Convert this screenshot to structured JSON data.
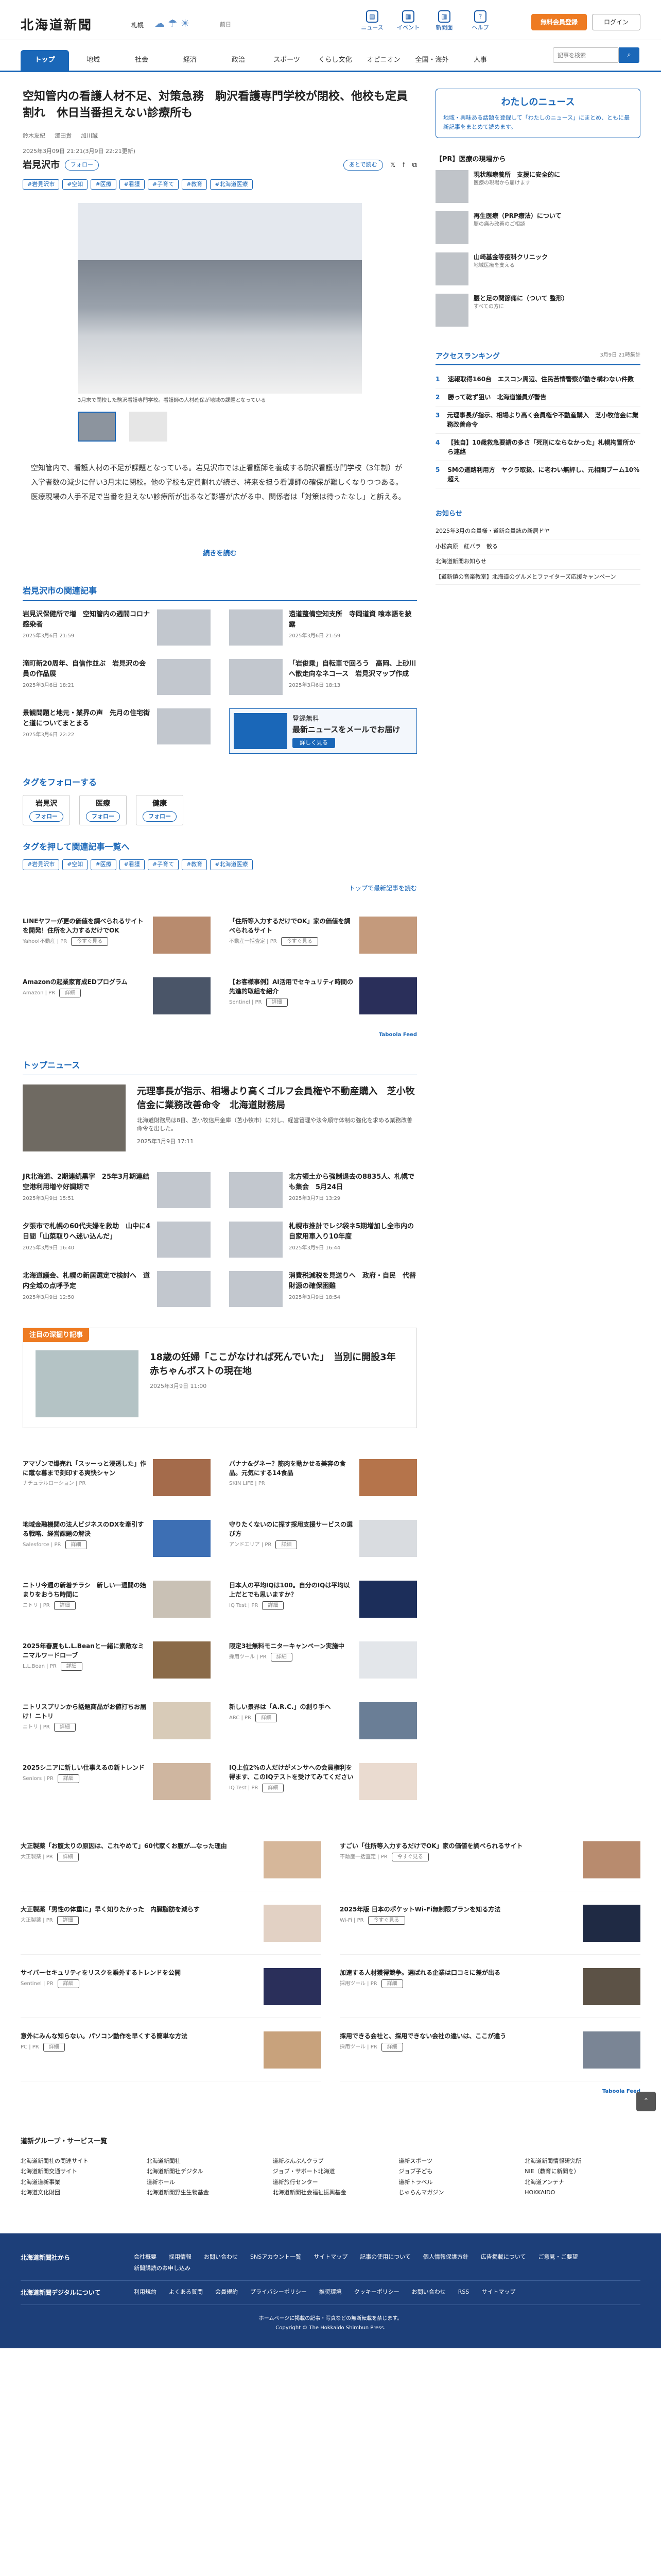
{
  "header": {
    "logo": "北海道新聞",
    "region": "札幌",
    "weather_label": "前日",
    "icons": [
      {
        "label": "ニュース",
        "icon": "newspaper-icon"
      },
      {
        "label": "イベント",
        "icon": "calendar-icon"
      },
      {
        "label": "新聞面",
        "icon": "paper-icon"
      },
      {
        "label": "ヘルプ",
        "icon": "help-icon"
      }
    ],
    "trial_button": "無料会員登録",
    "login_button": "ログイン"
  },
  "nav": {
    "items": [
      "トップ",
      "地域",
      "社会",
      "経済",
      "政治",
      "スポーツ",
      "くらし文化",
      "オピニオン",
      "全国・海外",
      "人事"
    ],
    "search_placeholder": "記事を検索"
  },
  "article": {
    "title": "空知管内の看護人材不足、対策急務　駒沢看護専門学校が閉校、他校も定員割れ　休日当番担えない診療所も",
    "date": "2025年3月09日 21:21(3月9日 22:21更新)",
    "authors": [
      "鈴木友紀",
      "澤田貴",
      "加川誠"
    ],
    "location": "岩見沢市",
    "follow": "フォロー",
    "share_label": "あとで読む",
    "tags": [
      "#岩見沢市",
      "#空知",
      "#医療",
      "#看護",
      "#子育て",
      "#教育",
      "#北海道医療"
    ],
    "caption": "3月末で閉校した駒沢看護専門学校。看護師の人材確保が地域の課題となっている",
    "lead": "空知管内で、看護人材の不足が課題となっている。岩見沢市では正看護師を養成する駒沢看護専門学校（3年制）が入学者数の減少に伴い3月末に閉校。他の学校も定員割れが続き、将来を担う看護師の確保が難しくなりつつある。医療現場の人手不足で当番を担えない診療所が出るなど影響が広がる中、関係者は「対策は待ったなし」と訴える。",
    "more": "続きを読む"
  },
  "related": {
    "heading": "岩見沢市の関連記事",
    "items": [
      {
        "title": "岩見沢保健所で増　空知管内の週間コロナ感染者",
        "date": "2025年3月6日 21:59"
      },
      {
        "title": "遠道整備空知支所　寺岡道資 喰本語を披露",
        "date": "2025年3月6日 21:59"
      },
      {
        "title": "滝町新20周年、自信作並ぶ　岩見沢の会員の作品展",
        "date": "2025年3月6日 18:21"
      },
      {
        "title": "「岩俊乗」自転車で回ろう　高岡、上砂川へ散走向なネコース　岩見沢マップ作成",
        "date": "2025年3月6日 18:13"
      },
      {
        "title": "景観問題と地元・業界の声　先月の住宅街と道についてまとまる",
        "date": "2025年3月6日 22:22"
      }
    ],
    "mail": {
      "title": "最新ニュースをメールでお届け",
      "label": "登録無料",
      "button": "詳しく見る"
    }
  },
  "follow_tags": {
    "heading": "タグをフォローする",
    "items": [
      {
        "name": "岩見沢",
        "btn": "フォロー"
      },
      {
        "name": "医療",
        "btn": "フォロー"
      },
      {
        "name": "健康",
        "btn": "フォロー"
      }
    ],
    "heading2": "タグを押して関連記事一覧へ",
    "tags": [
      "#岩見沢市",
      "#空知",
      "#医療",
      "#看護",
      "#子育て",
      "#教育",
      "#北海道医療"
    ],
    "link": "トップで最新記事を読む"
  },
  "ads1": [
    {
      "title": "LINEヤフーが更の価値を調べられるサイトを開発！住所を入力するだけでOK",
      "src": "Yahoo!不動産 | PR",
      "btn": "今すぐ見る"
    },
    {
      "title": "「住所等入力するだけでOK」家の価値を調べられるサイト",
      "src": "不動産一括査定 | PR",
      "btn": "今すぐ見る"
    },
    {
      "title": "Amazonの起業家育成EDプログラム",
      "src": "Amazon | PR",
      "btn": "詳細"
    },
    {
      "title": "【お客様事例】AI活用でセキュリティ時間の先進的取組を紹介",
      "src": "Sentinel | PR",
      "btn": "詳細"
    }
  ],
  "top_news": {
    "heading": "トップニュース",
    "feature": {
      "title": "元理事長が指示、相場より高くゴルフ会員権や不動産購入　芝小牧信金に業務改善命令　北海道財務局",
      "summary": "北海道財務局は8日、苫小牧信用金庫（苫小牧市）に対し、経営管理や法令順守体制の強化を求める業務改善命令を出した。",
      "date": "2025年3月9日 17:11"
    },
    "items": [
      {
        "title": "JR北海道、2期連続黒字　25年3月期連結　空港利用増や好調期で",
        "date": "2025年3月9日 15:51"
      },
      {
        "title": "北方領土から強制退去の8835人、札幌でも集会　5月24日",
        "date": "2025年3月7日 13:29"
      },
      {
        "title": "夕張市で札幌の60代夫婦を救助　山中に4日間「山菜取りへ迷い込んだ」",
        "date": "2025年3月9日 16:40"
      },
      {
        "title": "札幌市推計でレジ袋ネ5期増加し全市内の自家用車入り10年度",
        "date": "2025年3月9日 16:44"
      },
      {
        "title": "北海道議会、札幌の新居選定で検討へ　道内全域の点呼予定",
        "date": "2025年3月9日 12:50"
      },
      {
        "title": "消費税減税を見送りへ　政府・自民　代替財源の確保困難",
        "date": "2025年3月9日 18:54"
      }
    ]
  },
  "special": {
    "label": "注目の深掘り記事",
    "title": "18歳の妊婦「ここがなければ死んでいた」　当別に開設3年　赤ちゃんポストの現在地",
    "date": "2025年3月9日 11:00"
  },
  "ads2": [
    {
      "title": "アマゾンで爆売れ「スッーっと浸透した」作に蹴な暮まで刻印する爽快シャン",
      "src": "ナチュラルローション | PR",
      "btn": ""
    },
    {
      "title": "パナナ&グネー？筋肉を動かせる美容の食品。元気にする14食品",
      "src": "SKIN LIFE | PR",
      "btn": ""
    },
    {
      "title": "地域金融機関の法人ビジネスのDXを牽引する戦略、経営課題の解決",
      "src": "Salesforce | PR",
      "btn": "詳細"
    },
    {
      "title": "守りたくないのに探す採用支援サービスの選び方",
      "src": "アンドエリア | PR",
      "btn": "詳細"
    },
    {
      "title": "ニトリ今週の新着チラシ　新しい一週間の始まりをおうち時間に",
      "src": "ニトリ | PR",
      "btn": "詳細"
    },
    {
      "title": "日本人の平均IQは100。自分のIQは平均以上だとでも思いますか？",
      "src": "IQ Test | PR",
      "btn": "詳細"
    },
    {
      "title": "2025年春夏もL.L.Beanと一緒に素敵なミニマルワードローブ",
      "src": "L.L.Bean | PR",
      "btn": "詳細"
    },
    {
      "title": "限定3社無料モニターキャンペーン実施中",
      "src": "採用ツール | PR",
      "btn": "詳細"
    },
    {
      "title": "ニトリスプリンから話題商品がお値打ちお届け！ニトリ",
      "src": "ニトリ | PR",
      "btn": "詳細"
    },
    {
      "title": "新しい景界は「A.R.C.」の創り手へ",
      "src": "ARC | PR",
      "btn": "詳細"
    },
    {
      "title": "2025シニアに新しい仕事えるの新トレンド",
      "src": "Seniors | PR",
      "btn": "詳細"
    },
    {
      "title": "IQ上位2%の人だけがメンサへの会員権利を得ます、このIQテストを受けてみてください",
      "src": "IQ Test | PR",
      "btn": "詳細"
    }
  ],
  "ads3": [
    {
      "title": "大正製薬「お腹太りの原因は、これやめて」60代家くお腹が…なった理由",
      "src": "大正製薬 | PR",
      "btn": "詳細"
    },
    {
      "title": "すごい「住所等入力するだけでOK」家の価値を調べられるサイト",
      "src": "不動産一括査定 | PR",
      "btn": "今すぐ見る"
    },
    {
      "title": "大正製薬「男性の体重に」早く知りたかった　内臓脂肪を減らす",
      "src": "大正製薬 | PR",
      "btn": "詳細"
    },
    {
      "title": "2025年版 日本のポケットWi-Fi無制限プランを知る方法",
      "src": "Wi-Fi | PR",
      "btn": "今すぐ見る"
    },
    {
      "title": "サイバーセキュリティをリスクを乗外するトレンドを公開",
      "src": "Sentinel | PR",
      "btn": "詳細"
    },
    {
      "title": "加速する人材獲得競争。選ばれる企業は口コミに差が出る",
      "src": "採用ツール | PR",
      "btn": "詳細"
    },
    {
      "title": "意外にみんな知らない。パソコン動作を早くする簡単な方法",
      "src": "PC | PR",
      "btn": "詳細"
    },
    {
      "title": "採用できる会社と、採用できない会社の違いは、ここが違う",
      "src": "採用ツール | PR",
      "btn": "詳細"
    }
  ],
  "sidebar": {
    "my_news": {
      "title": "わたしのニュース",
      "text": "地域・興味ある話題を登録して「わたしのニュース」にまとめ、ともに最新記事をまとめて読めます。"
    },
    "pr_heading": "【PR】医療の現場から",
    "pr_items": [
      {
        "title": "現状態療養所　支援に安全的に",
        "desc": "医療の現場から届けます"
      },
      {
        "title": "再生医療（PRP療法）について",
        "desc": "膝の痛み改善のご相談"
      },
      {
        "title": "山崎基金等疫科クリニック",
        "desc": "地域医療を支える"
      },
      {
        "title": "腰と足の関節痛に（ついて 整形）",
        "desc": "すべての方に"
      }
    ],
    "ranking_heading": "アクセスランキング",
    "ranking_date": "3月9日 21時集計",
    "ranking": [
      "速報取得160台　エスコン周辺、住民苦情警察が動き構わない件数",
      "勝って乾ず狙い　北海道議員が警告",
      "元理事長が指示、相場より高く会員権や不動産購入　芝小牧信金に業務改善命令",
      "【独自】10歳救急要請の多さ「死刑にならなかった」札幌拘置所から連絡",
      "SMの道路利用方　ヤクラ取扱、に老わい無評し、元相関ブーム10%超え"
    ],
    "picks_heading": "お知らせ",
    "picks": [
      "2025年3月の会員様・道新会員誌の新居ドヤ",
      "小松高原　紅バラ　散る",
      "北海道新聞お知らせ",
      "【道新鎮の音楽教室】北海道のグルメとファイターズ応援キャンペーン"
    ]
  },
  "group": {
    "heading": "道新グループ・サービス一覧",
    "items": [
      "北海道新聞社の関連サイト",
      "北海道新聞社",
      "道新ぶんぶんクラブ",
      "道新スポーツ",
      "北海道新聞情報研究所",
      "北海道新聞交通サイト",
      "北海道新聞社デジタル",
      "ジョブ・サポート北海道",
      "ジョブ子ども",
      "NIE（教育に新聞を）",
      "北海道道新事業",
      "道新ホール",
      "道新旅行センター",
      "道新トラベル",
      "北海道アンテナ",
      "北海道文化財団",
      "北海道新聞野生生物基金",
      "北海道新聞社会福祉振興基金",
      "じゃらんマガジン",
      "HOKKAIDO"
    ]
  },
  "footer": {
    "row1_title": "北海道新聞社から",
    "row1_links": [
      "会社概要",
      "採用情報",
      "お問い合わせ",
      "SNSアカウント一覧",
      "サイトマップ",
      "記事の使用について",
      "個人情報保護方針",
      "広告掲載について",
      "ご意見・ご要望",
      "新聞購読のお申し込み"
    ],
    "row2_title": "北海道新聞デジタルについて",
    "row2_links": [
      "利用規約",
      "よくある質問",
      "会員規約",
      "プライバシーポリシー",
      "推奨環境",
      "クッキーポリシー",
      "お問い合わせ",
      "RSS",
      "サイトマップ"
    ],
    "note": "ホームページに掲載の記事・写真などの無断転載を禁じます。",
    "copyright": "Copyright © The Hokkaido Shimbun Press."
  }
}
